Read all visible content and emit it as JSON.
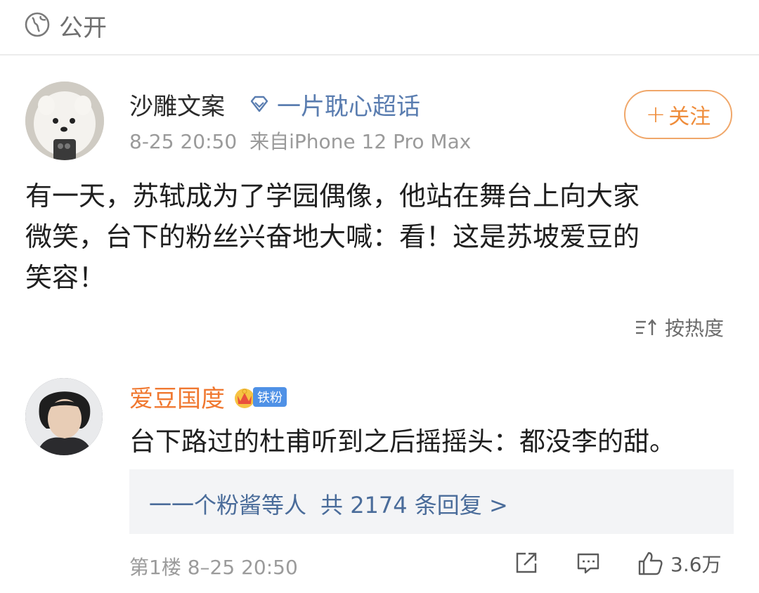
{
  "visibility": {
    "label": "公开",
    "icon": "globe-icon"
  },
  "post": {
    "author": "沙雕文案",
    "topic_tag": "一片耽心超话",
    "timestamp": "8-25 20:50",
    "source": "来自iPhone 12 Pro Max",
    "follow_label": "关注",
    "body_lines": [
      "有一天，苏轼成为了学园偶像，他站在舞台上向大家",
      "微笑，台下的粉丝兴奋地大喊：看！这是苏坡爱豆的",
      "笑容！"
    ]
  },
  "sort": {
    "label": "按热度",
    "icon": "sort-icon"
  },
  "comment": {
    "author": "爱豆国度",
    "fan_badge": "铁粉",
    "text": "台下路过的杜甫听到之后摇摇头：都没李的甜。",
    "reply_summary": {
      "who": "一一个粉酱等人",
      "count": "共 2174 条回复 >"
    },
    "floor": "第1楼",
    "timestamp": "8–25 20:50",
    "likes": "3.6万"
  },
  "colors": {
    "accent_orange": "#ef8c3a",
    "link_blue": "#4a6c9a",
    "badge_blue": "#4f91e6"
  }
}
